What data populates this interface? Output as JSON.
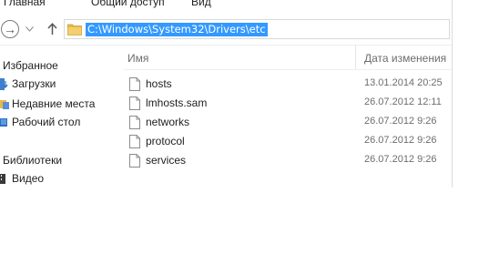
{
  "ribbon": {
    "tabs": [
      "Главная",
      "Общий доступ",
      "Вид"
    ]
  },
  "navigation": {
    "back_icon": "back-arrow-icon",
    "forward_icon": "dropdown-arrow-icon",
    "up_icon": "up-arrow-icon"
  },
  "address_bar": {
    "value": "C:\\Windows\\System32\\Drivers\\etc",
    "icon": "folder-icon"
  },
  "sidebar": {
    "favorites_header": "Избранное",
    "favorites": [
      {
        "label": "Загрузки",
        "icon": "downloads-icon"
      },
      {
        "label": "Недавние места",
        "icon": "recent-places-icon"
      },
      {
        "label": "Рабочий стол",
        "icon": "desktop-icon"
      }
    ],
    "libraries_header": "Библиотеки",
    "libraries": [
      {
        "label": "Видео",
        "icon": "video-library-icon"
      }
    ]
  },
  "file_list": {
    "columns": {
      "name": "Имя",
      "date": "Дата изменения"
    },
    "files": [
      {
        "name": "hosts",
        "date": "13.01.2014 20:25"
      },
      {
        "name": "lmhosts.sam",
        "date": "26.07.2012 12:11"
      },
      {
        "name": "networks",
        "date": "26.07.2012 9:26"
      },
      {
        "name": "protocol",
        "date": "26.07.2012 9:26"
      },
      {
        "name": "services",
        "date": "26.07.2012 9:26"
      }
    ]
  },
  "colors": {
    "selection": "#3399ff",
    "folder": "#e8b84a",
    "text": "#1e1e1e",
    "muted_text": "#6d6d6d"
  }
}
